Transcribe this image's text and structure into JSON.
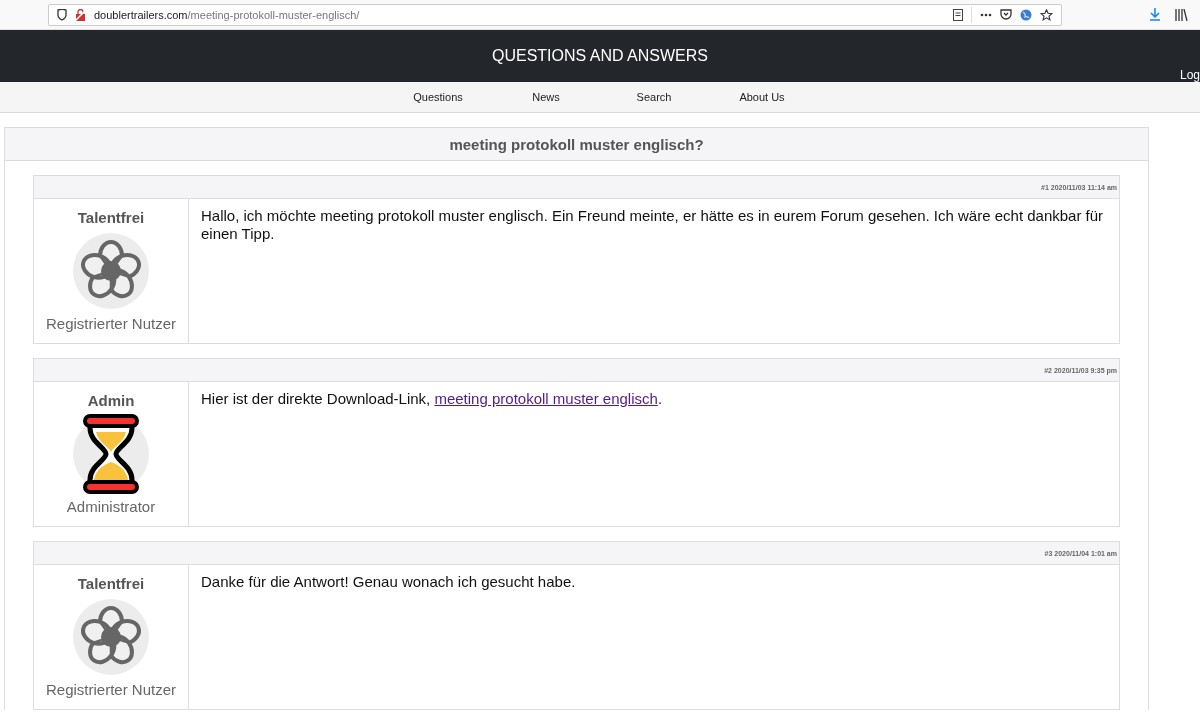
{
  "browser": {
    "url_domain": "doublertrailers.com",
    "url_path": "/meeting-protokoll-muster-englisch/"
  },
  "header": {
    "title": "QUESTIONS AND ANSWERS",
    "login": "Log"
  },
  "nav": [
    "Questions",
    "News",
    "Search",
    "About Us"
  ],
  "thread": {
    "title": "meeting protokoll muster englisch?",
    "posts": [
      {
        "meta": "#1 2020/11/03 11:14 am",
        "author": "Talentfrei",
        "role": "Registrierter Nutzer",
        "kind": "flower",
        "text": "Hallo, ich möchte meeting protokoll muster englisch. Ein Freund meinte, er hätte es in eurem Forum gesehen. Ich wäre echt dankbar für einen Tipp."
      },
      {
        "meta": "#2 2020/11/03 9:35 pm",
        "author": "Admin",
        "role": "Administrator",
        "kind": "hourglass",
        "text": "Hier ist der direkte Download-Link, ",
        "link": "meeting protokoll muster englisch",
        "after": "."
      },
      {
        "meta": "#3 2020/11/04 1:01 am",
        "author": "Talentfrei",
        "role": "Registrierter Nutzer",
        "kind": "flower",
        "text": "Danke für die Antwort! Genau wonach ich gesucht habe."
      }
    ]
  }
}
